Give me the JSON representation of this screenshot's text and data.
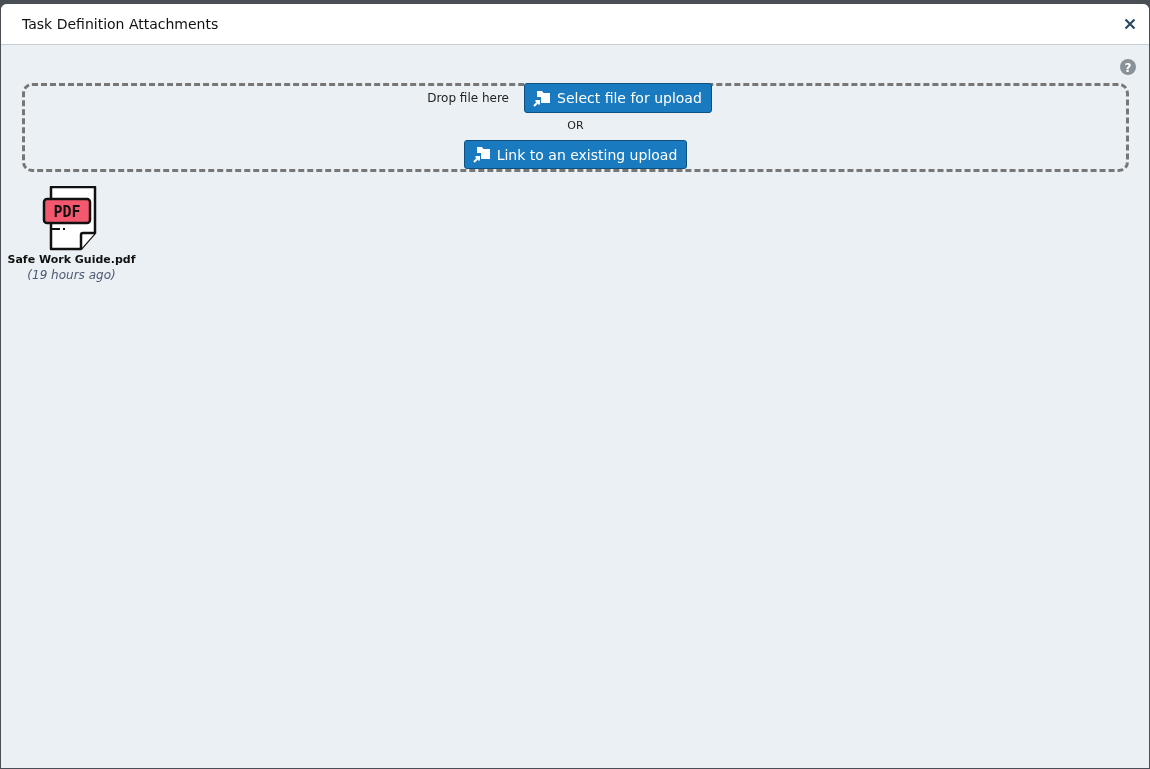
{
  "dialog": {
    "title": "Task Definition Attachments"
  },
  "help": {
    "glyph": "?"
  },
  "dropzone": {
    "hint": "Drop file here",
    "select_button": "Select file for upload",
    "separator": "OR",
    "link_button": "Link to an existing upload"
  },
  "files": [
    {
      "kind": "pdf",
      "badge": "PDF",
      "name": "Safe Work Guide.pdf",
      "age": "(19 hours ago)"
    }
  ]
}
